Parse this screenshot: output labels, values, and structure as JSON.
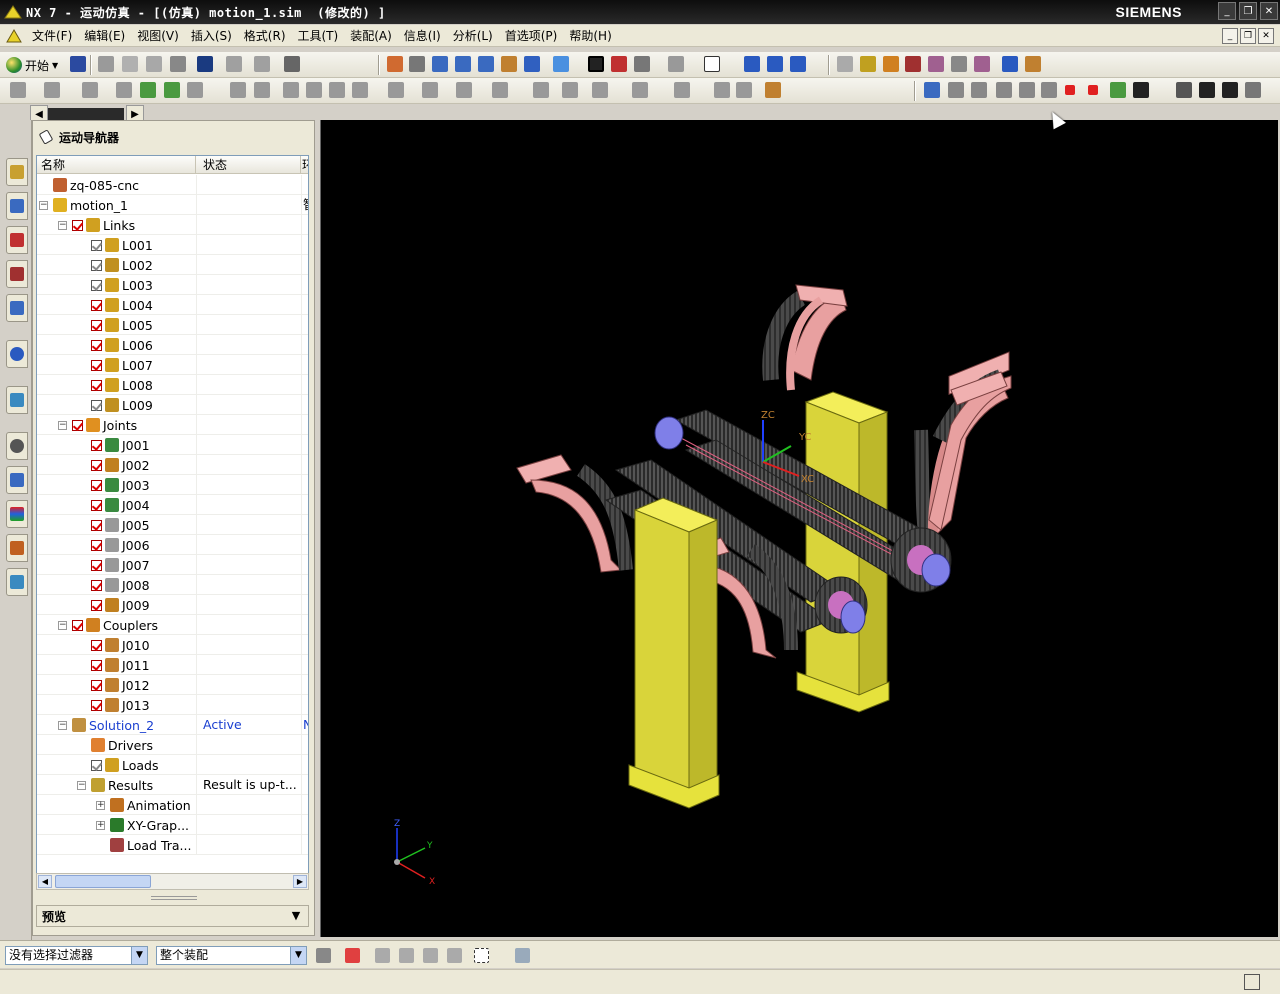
{
  "window": {
    "title": "NX 7 - 运动仿真 - [(仿真) motion_1.sim  (修改的) ]",
    "brand": "SIEMENS",
    "buttons": [
      "_",
      "❐",
      "✕"
    ]
  },
  "menu": {
    "items": [
      "文件(F)",
      "编辑(E)",
      "视图(V)",
      "插入(S)",
      "格式(R)",
      "工具(T)",
      "装配(A)",
      "信息(I)",
      "分析(L)",
      "首选项(P)",
      "帮助(H)"
    ]
  },
  "toolbar": {
    "start_label": "开始"
  },
  "navigator": {
    "title": "运动导航器",
    "columns": {
      "name": "名称",
      "status": "状态",
      "extra": "环"
    },
    "rows": [
      {
        "level": 0,
        "label": "zq-085-cnc",
        "icon": "assembly-icon",
        "check": "",
        "expander": "",
        "status": "",
        "extra": ""
      },
      {
        "level": 0,
        "label": "motion_1",
        "icon": "motion-icon",
        "check": "",
        "expander": "−",
        "status": "",
        "extra": "智"
      },
      {
        "level": 1,
        "label": "Links",
        "icon": "link-icon",
        "check": "on",
        "expander": "−",
        "status": "",
        "extra": ""
      },
      {
        "level": 2,
        "label": "L001",
        "icon": "link-icon",
        "check": "gray",
        "expander": "",
        "status": "",
        "extra": ""
      },
      {
        "level": 2,
        "label": "L002",
        "icon": "link-fixed-icon",
        "check": "gray",
        "expander": "",
        "status": "",
        "extra": ""
      },
      {
        "level": 2,
        "label": "L003",
        "icon": "link-icon",
        "check": "gray",
        "expander": "",
        "status": "",
        "extra": ""
      },
      {
        "level": 2,
        "label": "L004",
        "icon": "link-icon",
        "check": "on",
        "expander": "",
        "status": "",
        "extra": ""
      },
      {
        "level": 2,
        "label": "L005",
        "icon": "link-icon",
        "check": "on",
        "expander": "",
        "status": "",
        "extra": ""
      },
      {
        "level": 2,
        "label": "L006",
        "icon": "link-icon",
        "check": "on",
        "expander": "",
        "status": "",
        "extra": ""
      },
      {
        "level": 2,
        "label": "L007",
        "icon": "link-icon",
        "check": "on",
        "expander": "",
        "status": "",
        "extra": ""
      },
      {
        "level": 2,
        "label": "L008",
        "icon": "link-icon",
        "check": "on",
        "expander": "",
        "status": "",
        "extra": ""
      },
      {
        "level": 2,
        "label": "L009",
        "icon": "link-fixed-icon",
        "check": "gray",
        "expander": "",
        "status": "",
        "extra": ""
      },
      {
        "level": 1,
        "label": "Joints",
        "icon": "joint-icon",
        "check": "on",
        "expander": "−",
        "status": "",
        "extra": ""
      },
      {
        "level": 2,
        "label": "J001",
        "icon": "revolute-joint-icon",
        "check": "on",
        "expander": "",
        "status": "",
        "extra": ""
      },
      {
        "level": 2,
        "label": "J002",
        "icon": "fixed-joint-icon",
        "check": "on",
        "expander": "",
        "status": "",
        "extra": ""
      },
      {
        "level": 2,
        "label": "J003",
        "icon": "revolute-joint-icon",
        "check": "on",
        "expander": "",
        "status": "",
        "extra": ""
      },
      {
        "level": 2,
        "label": "J004",
        "icon": "revolute-joint-icon",
        "check": "on",
        "expander": "",
        "status": "",
        "extra": ""
      },
      {
        "level": 2,
        "label": "J005",
        "icon": "gray-joint-icon",
        "check": "on",
        "expander": "",
        "status": "",
        "extra": ""
      },
      {
        "level": 2,
        "label": "J006",
        "icon": "gray-joint-icon",
        "check": "on",
        "expander": "",
        "status": "",
        "extra": ""
      },
      {
        "level": 2,
        "label": "J007",
        "icon": "gray-joint-icon",
        "check": "on",
        "expander": "",
        "status": "",
        "extra": ""
      },
      {
        "level": 2,
        "label": "J008",
        "icon": "gray-joint-icon",
        "check": "on",
        "expander": "",
        "status": "",
        "extra": ""
      },
      {
        "level": 2,
        "label": "J009",
        "icon": "fixed-joint-icon",
        "check": "on",
        "expander": "",
        "status": "",
        "extra": ""
      },
      {
        "level": 1,
        "label": "Couplers",
        "icon": "coupler-icon",
        "check": "on",
        "expander": "−",
        "status": "",
        "extra": ""
      },
      {
        "level": 2,
        "label": "J010",
        "icon": "gear-coupler-icon",
        "check": "on",
        "expander": "",
        "status": "",
        "extra": ""
      },
      {
        "level": 2,
        "label": "J011",
        "icon": "gear-coupler-icon",
        "check": "on",
        "expander": "",
        "status": "",
        "extra": ""
      },
      {
        "level": 2,
        "label": "J012",
        "icon": "gear-coupler-icon",
        "check": "on",
        "expander": "",
        "status": "",
        "extra": ""
      },
      {
        "level": 2,
        "label": "J013",
        "icon": "gear-coupler-icon",
        "check": "on",
        "expander": "",
        "status": "",
        "extra": ""
      },
      {
        "level": 1,
        "label": "Solution_2",
        "icon": "solution-icon",
        "check": "",
        "expander": "−",
        "status": "Active",
        "extra": "N",
        "blue": true
      },
      {
        "level": 2,
        "label": "Drivers",
        "icon": "driver-icon",
        "check": "",
        "expander": "",
        "status": "",
        "extra": ""
      },
      {
        "level": 2,
        "label": "Loads",
        "icon": "load-icon",
        "check": "gray",
        "expander": "",
        "status": "",
        "extra": ""
      },
      {
        "level": 2,
        "label": "Results",
        "icon": "results-icon",
        "check": "",
        "expander": "−",
        "status": "Result is up-t...",
        "extra": ""
      },
      {
        "level": 3,
        "label": "Animation",
        "icon": "animation-icon",
        "check": "",
        "expander": "+",
        "status": "",
        "extra": ""
      },
      {
        "level": 3,
        "label": "XY-Grap...",
        "icon": "graph-icon",
        "check": "",
        "expander": "+",
        "status": "",
        "extra": ""
      },
      {
        "level": 3,
        "label": "Load Tra...",
        "icon": "load-transfer-icon",
        "check": "",
        "expander": "",
        "status": "",
        "extra": ""
      }
    ],
    "preview_label": "预览"
  },
  "viewport": {
    "wcs_labels": {
      "zc": "ZC",
      "yc": "YC",
      "xc": "XC"
    },
    "triad_labels": {
      "z": "Z",
      "y": "Y",
      "x": "X"
    }
  },
  "selection_bar": {
    "filter_value": "没有选择过滤器",
    "scope_value": "整个装配"
  },
  "colors": {
    "viewport_bg": "#000000",
    "post_yellow": "#e6e23c",
    "fork_pink": "#e8a0a0",
    "shaft_blue": "#7f7fe8",
    "gear_dark": "#3a3a3a"
  }
}
